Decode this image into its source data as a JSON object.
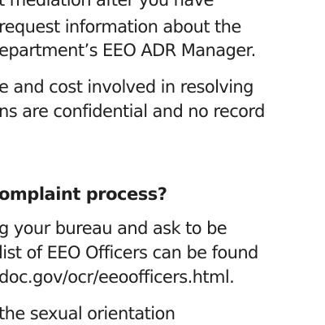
{
  "paragraph_mediation": {
    "lines": [
      "t mediation after you have",
      "request information about the",
      "epartment’s EEO ADR Manager."
    ]
  },
  "paragraph_cost": {
    "lines": [
      "e and cost involved in resolving",
      "ns are confidential and no record"
    ]
  },
  "section_heading": "omplaint process?",
  "paragraph_contact": {
    "lines": [
      "g your bureau and ask to be",
      "list of EEO Officers can be found",
      "doc.gov/ocr/eeoofficers.html."
    ]
  },
  "paragraph_orientation": {
    "lines": [
      " the sexual orientation"
    ]
  }
}
